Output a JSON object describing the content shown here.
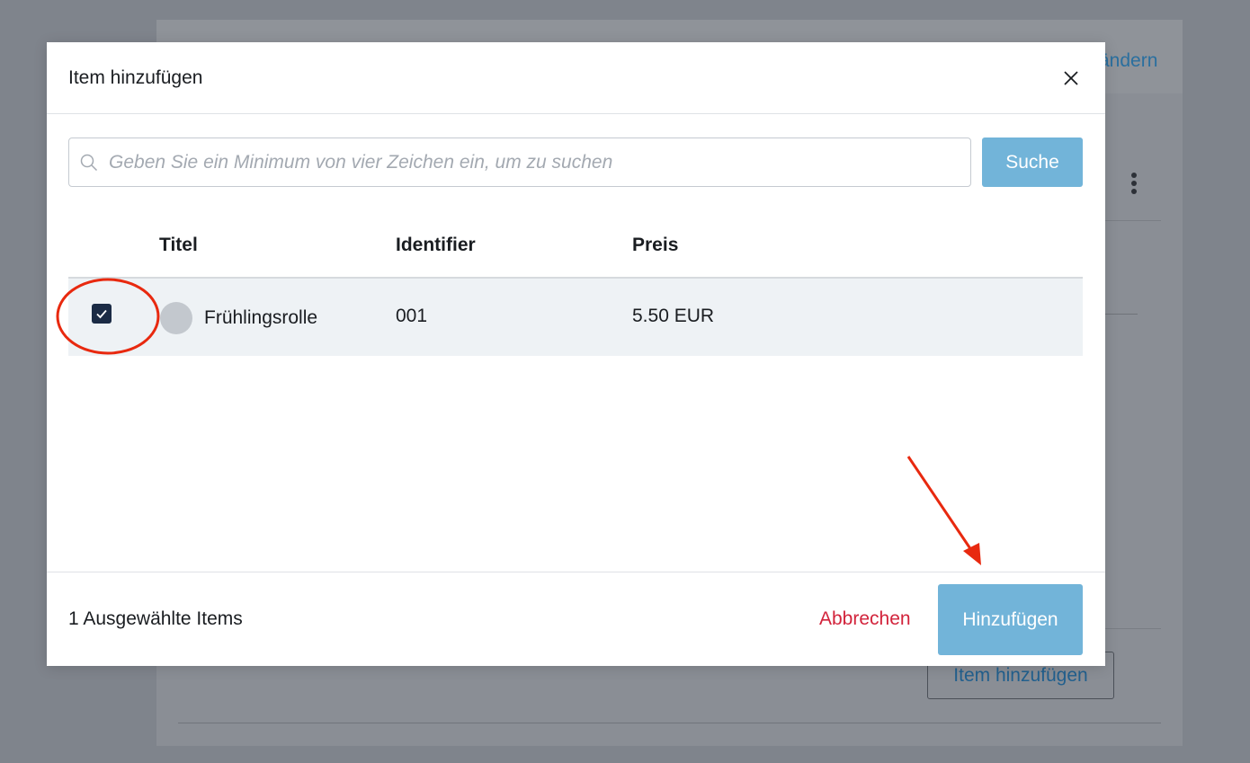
{
  "background": {
    "aendern_link": "ändern",
    "add_item_button": "Item hinzufügen"
  },
  "modal": {
    "title": "Item hinzufügen",
    "search": {
      "placeholder": "Geben Sie ein Minimum von vier Zeichen ein, um zu suchen",
      "value": "",
      "button_label": "Suche"
    },
    "table": {
      "columns": [
        "Titel",
        "Identifier",
        "Preis"
      ],
      "rows": [
        {
          "checked": true,
          "title": "Frühlingsrolle",
          "identifier": "001",
          "price": "5.50 EUR"
        }
      ]
    },
    "footer": {
      "selected_count": "1 Ausgewählte Items",
      "cancel_label": "Abbrechen",
      "add_label": "Hinzufügen"
    }
  },
  "colors": {
    "primary_button": "#72b4d9",
    "cancel_text": "#d2233b",
    "checkbox": "#1b2b45",
    "annotation": "#e8290f"
  }
}
